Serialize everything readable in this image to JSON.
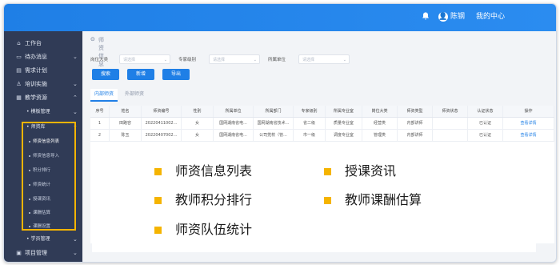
{
  "topbar": {
    "bell_icon": "bell-icon",
    "avatar_text": "👤",
    "user_name": "陈钢",
    "center_label": "我的中心"
  },
  "sidebar": {
    "items": [
      {
        "label": "工作台",
        "icon": "home-icon"
      },
      {
        "label": "待办消息",
        "icon": "message-icon",
        "arrow": "⌄"
      },
      {
        "label": "需求计划",
        "icon": "plan-icon"
      },
      {
        "label": "培训实施",
        "icon": "user-icon",
        "arrow": "⌄"
      },
      {
        "label": "教学资源",
        "icon": "resource-icon",
        "arrow": "⌃"
      }
    ],
    "sub_items": [
      {
        "label": "• 模板管理",
        "arrow": "⌄"
      },
      {
        "label": "• 师资库",
        "arrow": "⌃"
      }
    ],
    "subsub_items": [
      {
        "label": "师资信息列表"
      },
      {
        "label": "师资信息导入"
      },
      {
        "label": "积分排行"
      },
      {
        "label": "师资统计"
      },
      {
        "label": "授课资讯"
      },
      {
        "label": "课酬估算"
      },
      {
        "label": "课酬设置"
      }
    ],
    "tail_items": [
      {
        "label": "• 学员管理",
        "arrow": "⌄"
      },
      {
        "label": "项目管理",
        "icon": "project-icon",
        "arrow": "⌄"
      }
    ]
  },
  "main": {
    "breadcrumb": "师资信息",
    "filters": [
      {
        "label": "岗位大类",
        "placeholder": "请选择"
      },
      {
        "label": "专家级别",
        "placeholder": "请选择"
      },
      {
        "label": "所属单位",
        "placeholder": "请选择"
      }
    ],
    "buttons": {
      "search": "搜索",
      "add": "新增",
      "export": "导出"
    },
    "tabs": {
      "internal": "内部师资",
      "external": "外部师资"
    },
    "table": {
      "headers": [
        "序号",
        "姓名",
        "师资编号",
        "性别",
        "所属单位",
        "所属部门",
        "专家级别",
        "所属专业室",
        "岗位大类",
        "师资类型",
        "师资状态",
        "认证状态",
        "操作"
      ],
      "rows": [
        [
          "1",
          "田路容",
          "20220411002...",
          "女",
          "国网湖南省电...",
          "国网湖南省技术...",
          "省二级",
          "质量专业室",
          "经营类",
          "内部讲师",
          "",
          "已认证",
          "查看详情"
        ],
        [
          "2",
          "陈玉",
          "20220407002...",
          "女",
          "国网湖南省电...",
          "公司党校（管...",
          "市一级",
          "调度专业室",
          "管理类",
          "内部讲师",
          "",
          "已认证",
          "查看详情"
        ]
      ]
    }
  },
  "overlay": {
    "items": [
      "师资信息列表",
      "授课资讯",
      "教师积分排行",
      "教师课酬估算",
      "师资队伍统计"
    ]
  }
}
